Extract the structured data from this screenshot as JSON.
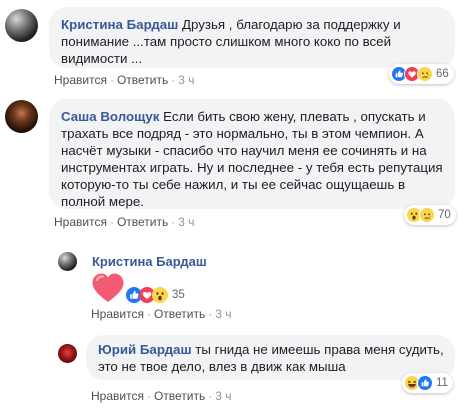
{
  "comments": [
    {
      "author": "Кристина Бардаш",
      "text": "Друзья , благодарю за поддержку и понимание ...там просто слишком много коко по всей видимости ...",
      "like_label": "Нравится",
      "reply_label": "Ответить",
      "time": "3 ч",
      "reactions": [
        "like-icon",
        "love-icon",
        "sad-icon"
      ],
      "reaction_count": "66"
    },
    {
      "author": "Саша Волощук",
      "text": "Если бить свою жену, плевать , опускать и трахать все подряд - это нормально, ты в этом чемпион. А насчёт музыки - спасибо что научил меня ее сочинять и на инструментах играть. Ну и последнее - у тебя есть репутация которую-то ты себе нажил, и ты ее сейчас ощущаешь в полной мере.",
      "like_label": "Нравится",
      "reply_label": "Ответить",
      "time": "3 ч",
      "reactions": [
        "wow-icon",
        "sad-icon"
      ],
      "reaction_count": "70"
    },
    {
      "author": "Кристина Бардаш",
      "sticker": "heart-sticker",
      "like_label": "Нравится",
      "reply_label": "Ответить",
      "time": "3 ч",
      "reactions": [
        "like-icon",
        "love-icon",
        "wow-icon"
      ],
      "reaction_count": "35"
    },
    {
      "author": "Юрий Бардаш",
      "text": "ты гнида не имеешь права меня судить, это не твое дело, влез в движ как мыша",
      "like_label": "Нравится",
      "reply_label": "Ответить",
      "time": "3 ч",
      "reactions": [
        "haha-icon",
        "like-icon"
      ],
      "reaction_count": "11"
    }
  ],
  "colors": {
    "bubble": "#f2f3f5",
    "author_link": "#385898",
    "like": "#2078f4",
    "love": "#f33e58",
    "emoji_yellow": "#fbd54b"
  }
}
